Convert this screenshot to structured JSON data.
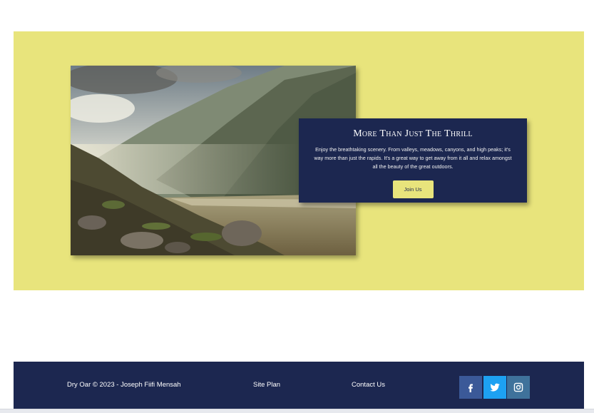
{
  "hero": {
    "photo_alt": "Mountain valley landscape",
    "card": {
      "title": "More Than Just The Thrill",
      "text": "Enjoy the breathtaking scenery. From valleys, meadows, canyons, and high peaks; it's way more than just the rapids. It's a great way to get away from it all and relax amongst all the beauty of the great outdoors.",
      "button_label": "Join Us"
    }
  },
  "footer": {
    "copyright": "Dry Oar © 2023 - Joseph Fiifi Mensah",
    "site_plan": "Site Plan",
    "contact_us": "Contact Us",
    "social": [
      {
        "icon": "facebook-icon",
        "color": "#3b5998"
      },
      {
        "icon": "twitter-icon",
        "color": "#1da1f2"
      },
      {
        "icon": "instagram-icon",
        "color": "#3f729b"
      }
    ]
  },
  "colors": {
    "accent_yellow": "#e8e47c",
    "navy": "#1c2750"
  }
}
